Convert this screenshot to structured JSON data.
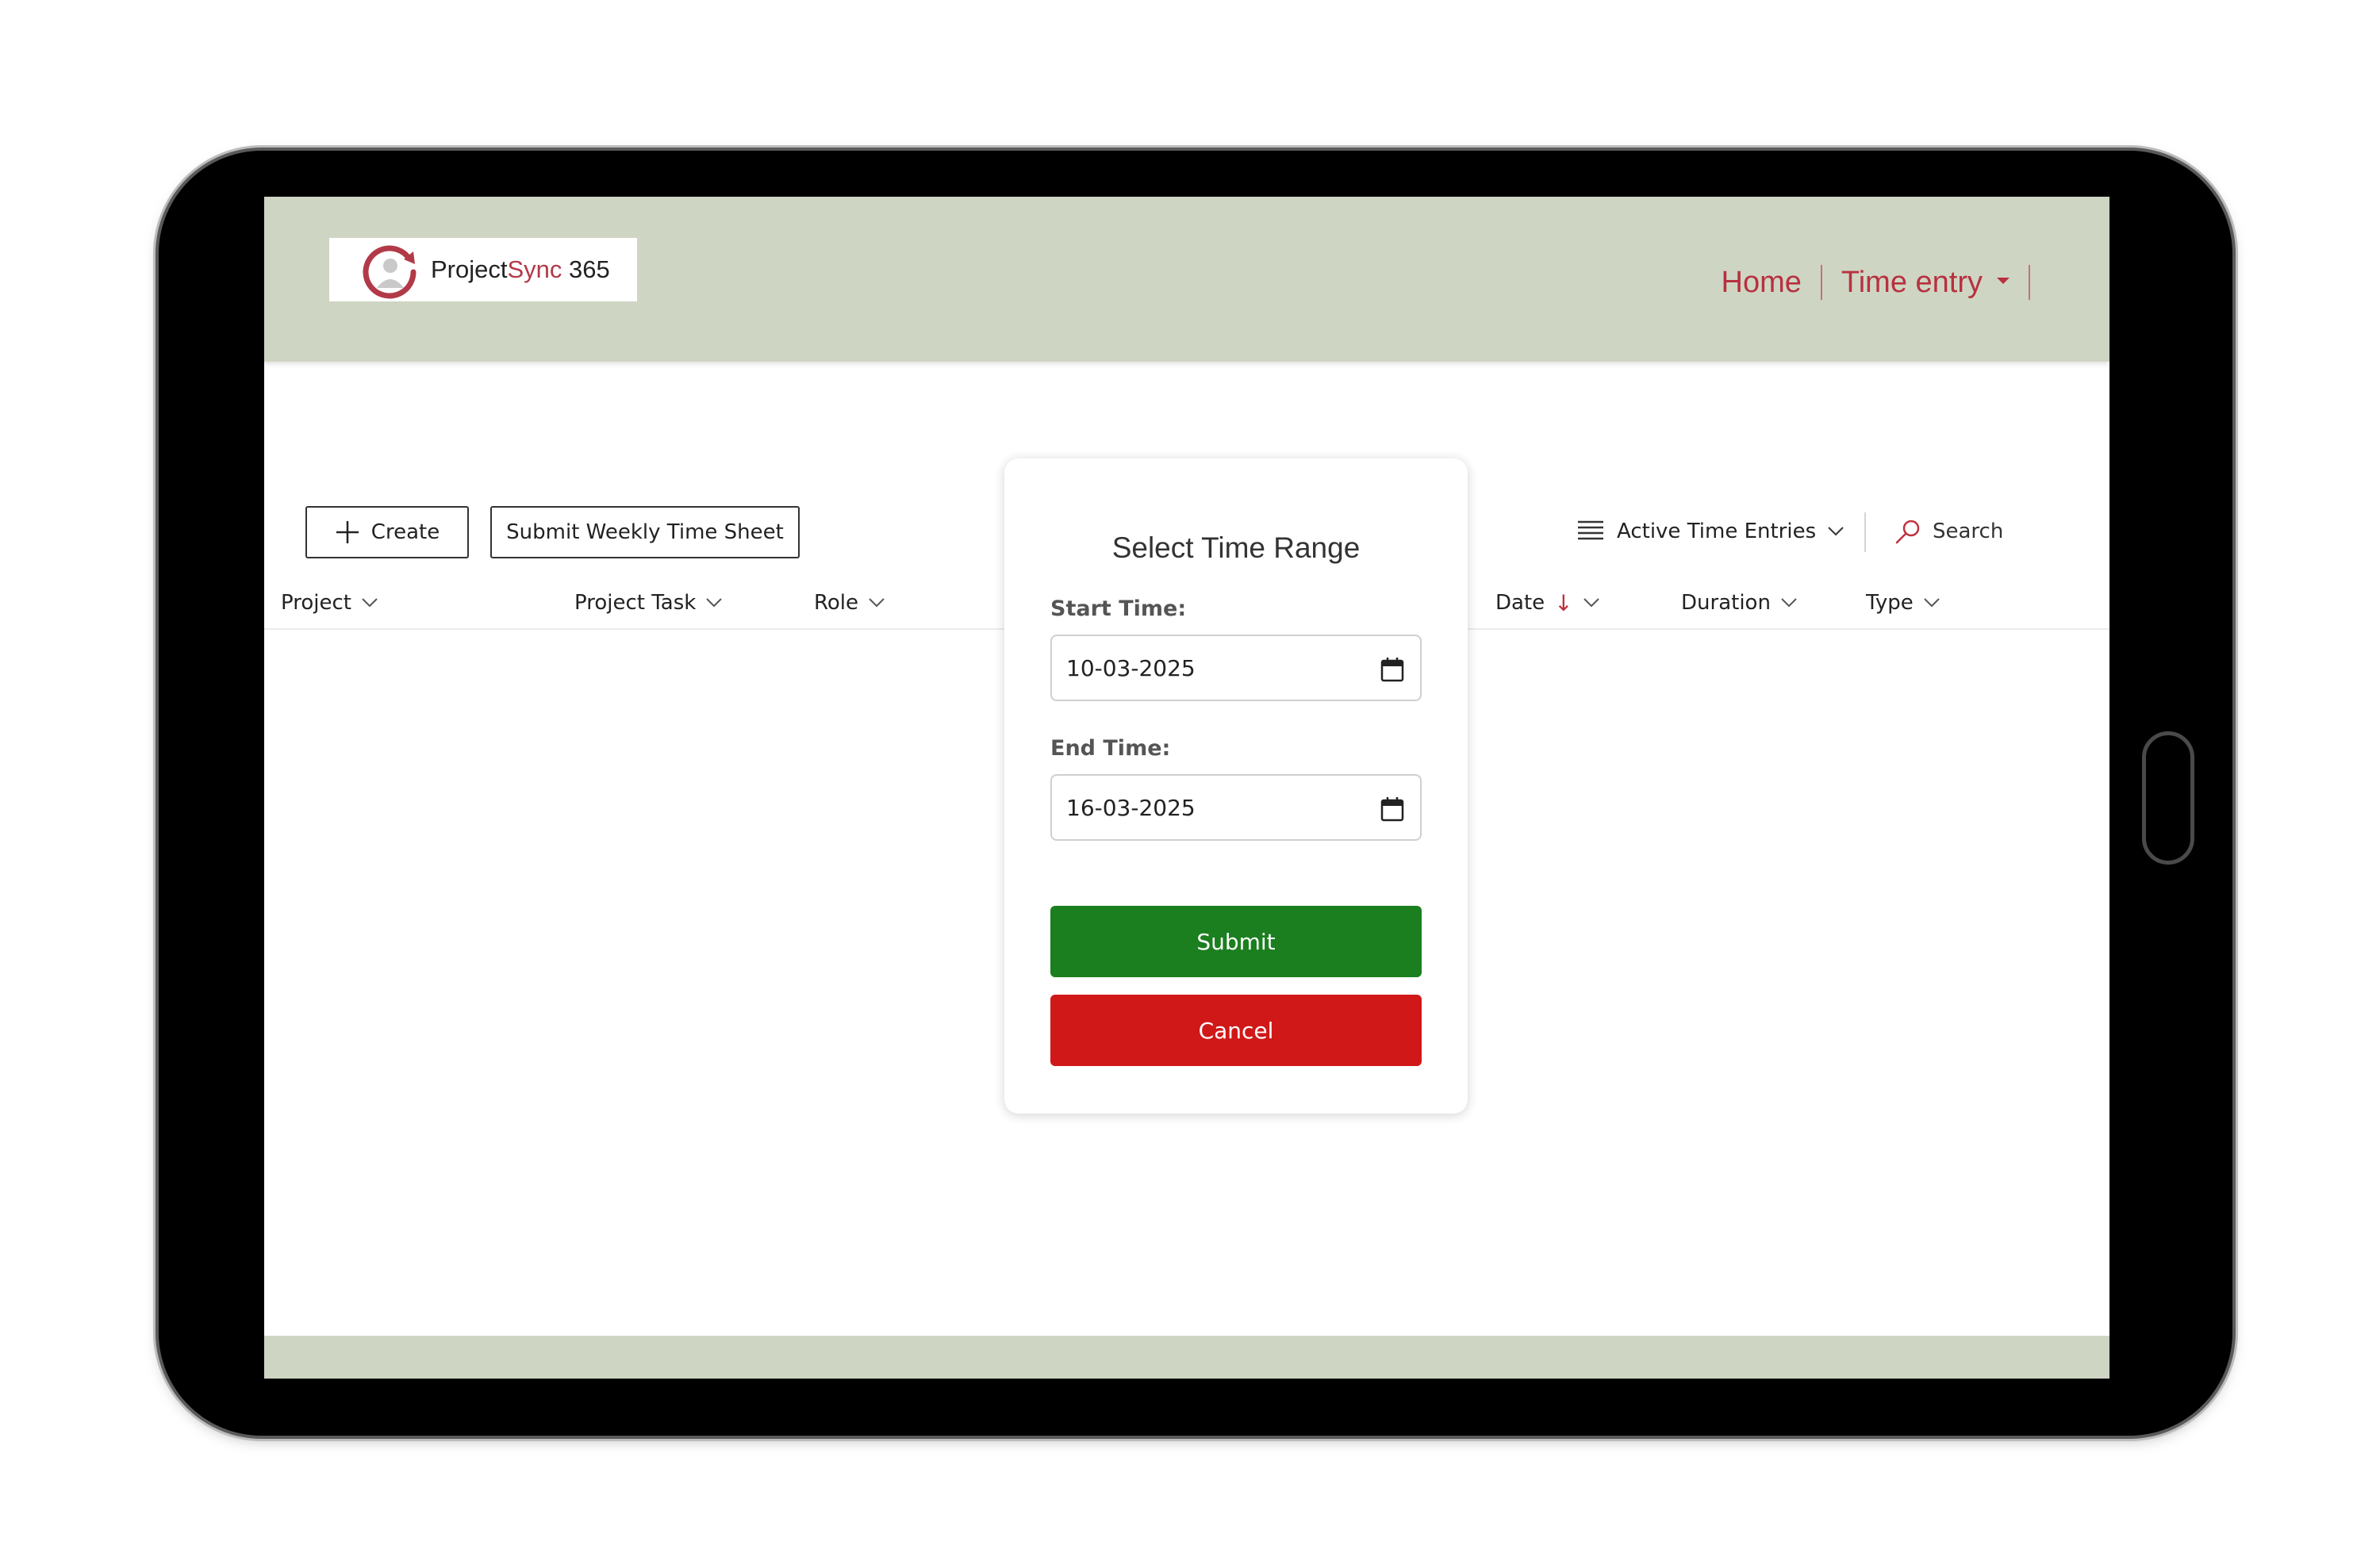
{
  "brand": {
    "name_part1": "Project",
    "name_part2": "Sync",
    "name_part3": " 365",
    "logo_icon": "clock-user-icon",
    "accent_color": "#b23a48"
  },
  "nav": {
    "home": "Home",
    "time_entry": "Time entry"
  },
  "toolbar": {
    "create_label": "Create",
    "submit_weekly_label": "Submit Weekly Time Sheet",
    "view_label": "Active Time Entries",
    "search_label": "Search"
  },
  "grid": {
    "columns": [
      {
        "label": "Project"
      },
      {
        "label": "Project Task"
      },
      {
        "label": "Role"
      },
      {
        "label": "Date",
        "sort": "descending"
      },
      {
        "label": "Duration"
      },
      {
        "label": "Type"
      }
    ]
  },
  "modal": {
    "title": "Select Time Range",
    "start_label": "Start Time:",
    "start_value": "10-03-2025",
    "end_label": "End Time:",
    "end_value": "16-03-2025",
    "submit_label": "Submit",
    "cancel_label": "Cancel",
    "submit_color": "#1b7f1f",
    "cancel_color": "#d01818"
  },
  "theme": {
    "header_bg": "#cfd5c3",
    "nav_color": "#b7313f"
  }
}
